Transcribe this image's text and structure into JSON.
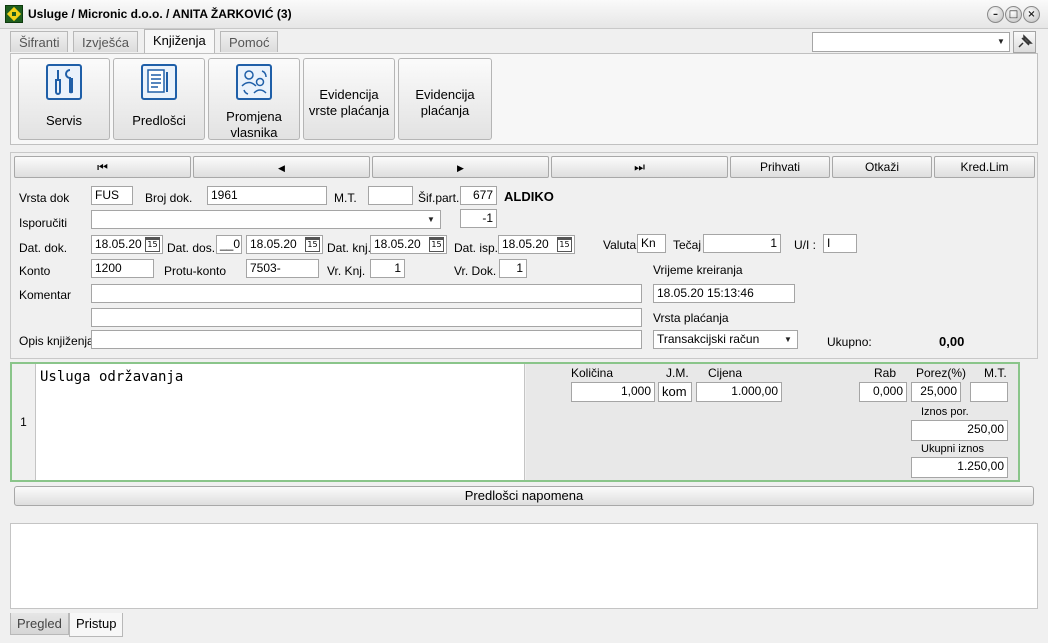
{
  "window": {
    "title": "Usluge / Micronic d.o.o. / ANITA ŽARKOVIĆ (3)"
  },
  "main_tabs": [
    {
      "label": "Šifranti"
    },
    {
      "label": "Izvješća"
    },
    {
      "label": "Knjiženja"
    },
    {
      "label": "Pomoć"
    }
  ],
  "ribbon": {
    "buttons": [
      {
        "label": "Servis",
        "icon": "tools-icon"
      },
      {
        "label": "Predlošci",
        "icon": "templates-icon"
      },
      {
        "label": "Promjena vlasnika",
        "icon": "owner-change-icon"
      },
      {
        "label": "Evidencija vrste plaćanja"
      },
      {
        "label": "Evidencija plaćanja"
      }
    ]
  },
  "nav": {
    "first": "⏮",
    "prev": "◀",
    "next": "▶",
    "last": "⏭",
    "accept": "Prihvati",
    "cancel": "Otkaži",
    "credit": "Kred.Lim"
  },
  "form": {
    "vrsta_dok_label": "Vrsta dok",
    "vrsta_dok": "FUS",
    "broj_dok_label": "Broj dok.",
    "broj_dok": "1961",
    "mt_label": "M.T.",
    "mt": "",
    "sif_part_label": "Šif.part.",
    "sif_part": "677",
    "partner_name": "ALDIKO",
    "isporuciti_label": "Isporučiti",
    "isporuciti": "",
    "isporuciti_code": "-1",
    "dat_dok_label": "Dat. dok.",
    "dat_dok": "18.05.20",
    "dat_dos_label": "Dat. dos.",
    "dat_dos_prefix": "__0",
    "dat_dos": "18.05.20",
    "dat_knj_label": "Dat. knj.",
    "dat_knj": "18.05.20",
    "dat_isp_label": "Dat. isp.",
    "dat_isp": "18.05.20",
    "calendar_glyph": "15",
    "valuta_label": "Valuta",
    "valuta": "Kn",
    "tecaj_label": "Tečaj",
    "tecaj": "1",
    "ui_label": "U/I :",
    "ui": "I",
    "konto_label": "Konto",
    "konto": "1200",
    "protu_konto_label": "Protu-konto",
    "protu_konto": "7503-",
    "vr_knj_label": "Vr. Knj.",
    "vr_knj": "1",
    "vr_dok_label": "Vr. Dok.",
    "vr_dok": "1",
    "vrijeme_label": "Vrijeme kreiranja",
    "vrijeme": "18.05.20 15:13:46",
    "komentar_label": "Komentar",
    "komentar": "",
    "komentar2": "",
    "vrsta_placanja_label": "Vrsta plaćanja",
    "vrsta_placanja": "Transakcijski račun",
    "opis_label": "Opis knjiženja",
    "opis": "",
    "ukupno_label": "Ukupno:",
    "ukupno": "0,00"
  },
  "item": {
    "row_number": "1",
    "description": "Usluga održavanja",
    "kolicina_label": "Količina",
    "kolicina": "1,000",
    "jm_label": "J.M.",
    "jm": "kom",
    "cijena_label": "Cijena",
    "cijena": "1.000,00",
    "rab_label": "Rab",
    "rab": "0,000",
    "porez_label": "Porez(%)",
    "porez": "25,000",
    "mt_label": "M.T.",
    "mt": "",
    "iznos_por_label": "Iznos por.",
    "iznos_por": "250,00",
    "ukupni_iznos_label": "Ukupni iznos",
    "ukupni_iznos": "1.250,00"
  },
  "notes_button": "Predlošci napomena",
  "bottom_tabs": [
    {
      "label": "Pregled"
    },
    {
      "label": "Pristup"
    }
  ],
  "colors": {
    "item_border": "#8ac58a",
    "icon_blue": "#1f5fa8"
  }
}
